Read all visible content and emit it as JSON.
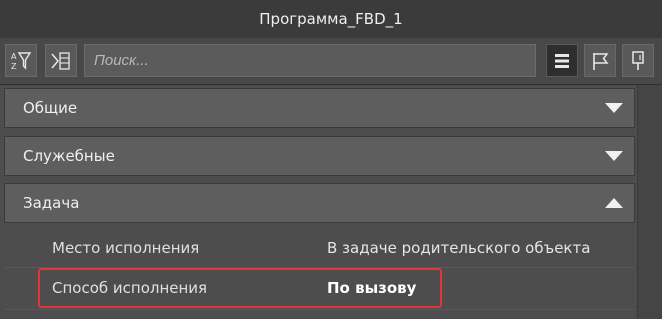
{
  "window": {
    "title": "Программа_FBD_1"
  },
  "toolbar": {
    "search_placeholder": "Поиск...",
    "buttons": [
      {
        "icon": "sort-filter-icon"
      },
      {
        "icon": "expand-collapse-icon"
      },
      {
        "icon": "list-view-icon"
      },
      {
        "icon": "flag-icon"
      },
      {
        "icon": "pin-icon"
      }
    ]
  },
  "sections": [
    {
      "label": "Общие",
      "expanded": false
    },
    {
      "label": "Служебные",
      "expanded": false
    },
    {
      "label": "Задача",
      "expanded": true
    }
  ],
  "properties": [
    {
      "name": "Место исполнения",
      "value": "В задаче родительского объекта"
    },
    {
      "name": "Способ исполнения",
      "value": "По вызову"
    }
  ],
  "colors": {
    "highlight": "#e0353a",
    "background": "#4a4a4a"
  }
}
